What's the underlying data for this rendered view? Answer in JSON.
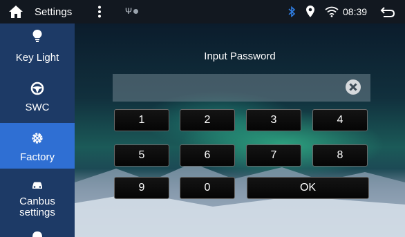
{
  "status_bar": {
    "title": "Settings",
    "usb_symbol": "Ψ",
    "time": "08:39",
    "icons": [
      "home-icon",
      "more-vertical-icon",
      "usb-icon",
      "bluetooth-icon",
      "location-pin-icon",
      "wifi-icon",
      "back-icon"
    ]
  },
  "sidebar": {
    "items": [
      {
        "label": "Key Light",
        "icon": "lightbulb-icon",
        "active": false
      },
      {
        "label": "SWC",
        "icon": "steering-wheel-icon",
        "active": false
      },
      {
        "label": "Factory",
        "icon": "gear-tools-icon",
        "active": true
      },
      {
        "label": "Canbus settings",
        "label_line1": "Canbus",
        "label_line2": "settings",
        "icon": "car-icon",
        "active": false
      }
    ]
  },
  "password": {
    "title": "Input Password",
    "value": ""
  },
  "keypad": {
    "keys": [
      "1",
      "2",
      "3",
      "4",
      "5",
      "6",
      "7",
      "8",
      "9",
      "0",
      "OK"
    ]
  },
  "colors": {
    "sidebar_bg": "#1d3a66",
    "sidebar_active": "#2f6fd3",
    "status_bar_bg": "#121820",
    "bluetooth": "#2f7de1"
  }
}
